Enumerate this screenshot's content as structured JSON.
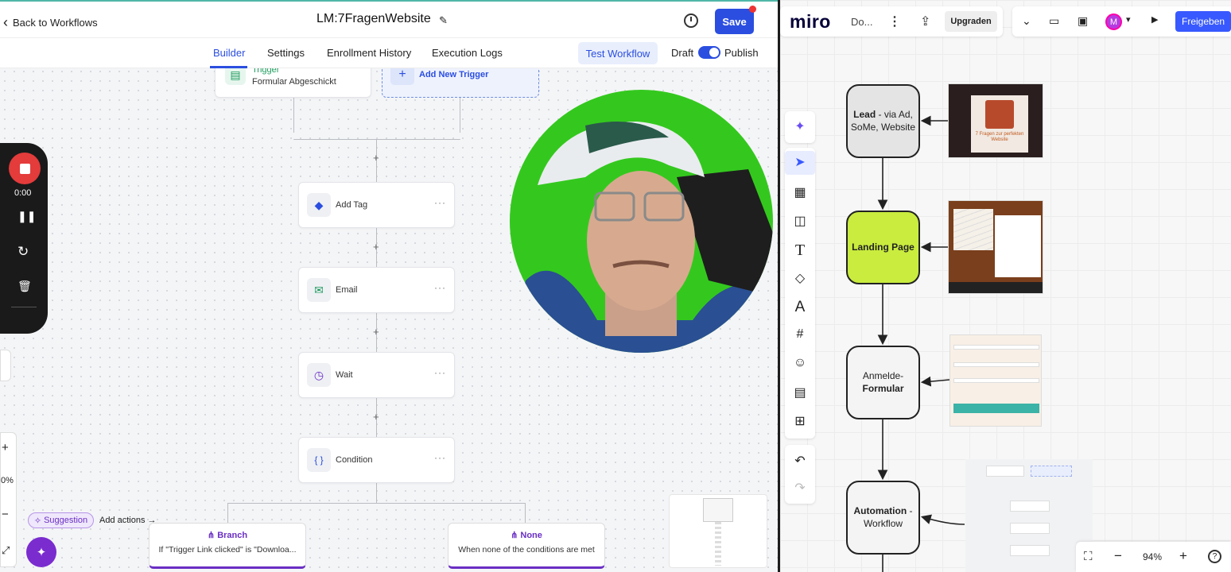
{
  "workflow": {
    "back_label": "Back to Workflows",
    "name": "LM:7FragenWebsite",
    "save_label": "Save",
    "tabs": [
      "Builder",
      "Settings",
      "Enrollment History",
      "Execution Logs"
    ],
    "test_label": "Test Workflow",
    "draft_label": "Draft",
    "publish_label": "Publish",
    "trigger_title": "Trigger",
    "trigger_sub": "Formular Abgeschickt",
    "add_trigger": "Add New Trigger",
    "nodes": [
      "Add Tag",
      "Email",
      "Wait",
      "Condition"
    ],
    "recorder_time": "0:00",
    "zoom_partial": "0%",
    "suggestion": "Suggestion",
    "add_actions": "Add actions",
    "branch_title": "Branch",
    "branch_sub": "If \"Trigger Link clicked\" is \"Downloa...",
    "none_title": "None",
    "none_sub": "When none of the conditions are met"
  },
  "miro": {
    "logo": "miro",
    "board": "Do...",
    "upgrade": "Upgraden",
    "avatar": "M",
    "share": "Freigeben",
    "zoom": "94%",
    "flow": {
      "lead_bold": "Lead",
      "lead_rest": " - via Ad, SoMe, Website",
      "landing": "Landing Page",
      "anmelde_top": "Anmelde-",
      "anmelde_bold": "Formular",
      "automation_bold": "Automation",
      "automation_rest": " - Workflow"
    },
    "thumb_text": "7 Fragen zur perfekten Website",
    "colors": {
      "landing": "#c9ec3e",
      "lead": "#e4e4e4",
      "accent": "#3859ff"
    }
  },
  "colors": {
    "primary": "#2b4ee0",
    "purple": "#6a2fc4",
    "record": "#e43b3b"
  }
}
